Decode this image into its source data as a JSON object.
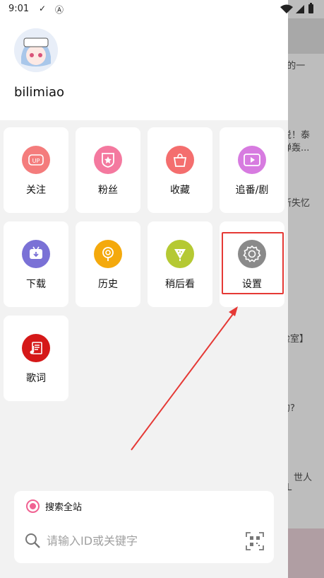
{
  "status_bar": {
    "time": "9:01",
    "check_icon": "checkmark-icon",
    "a_icon": "letter-a-icon"
  },
  "profile": {
    "username": "bilimiao"
  },
  "tiles": [
    {
      "label": "关注",
      "icon": "up-icon",
      "color": "#f47c7c"
    },
    {
      "label": "粉丝",
      "icon": "fans-badge-icon",
      "color": "#f4799f"
    },
    {
      "label": "收藏",
      "icon": "favorite-box-icon",
      "color": "#f46e6e"
    },
    {
      "label": "追番/剧",
      "icon": "video-icon",
      "color": "#d77be0"
    },
    {
      "label": "下载",
      "icon": "download-tv-icon",
      "color": "#7a71d6"
    },
    {
      "label": "历史",
      "icon": "history-icon",
      "color": "#f4a90c"
    },
    {
      "label": "稍后看",
      "icon": "watch-later-icon",
      "color": "#b5c933"
    },
    {
      "label": "设置",
      "icon": "settings-gear-icon",
      "color": "#8a8a8a"
    },
    {
      "label": "歌词",
      "icon": "lyrics-icon",
      "color": "#d51818"
    }
  ],
  "search": {
    "scope_label": "搜索全站",
    "placeholder": "请输入ID或关键字"
  },
  "background_texts": [
    "E的一",
    "说！泰",
    "弹轰...",
    "新失忆",
    "脸室】",
    "的?",
    "世人",
    "L"
  ],
  "colors": {
    "accent": "#f06292",
    "highlight": "#e53935"
  }
}
